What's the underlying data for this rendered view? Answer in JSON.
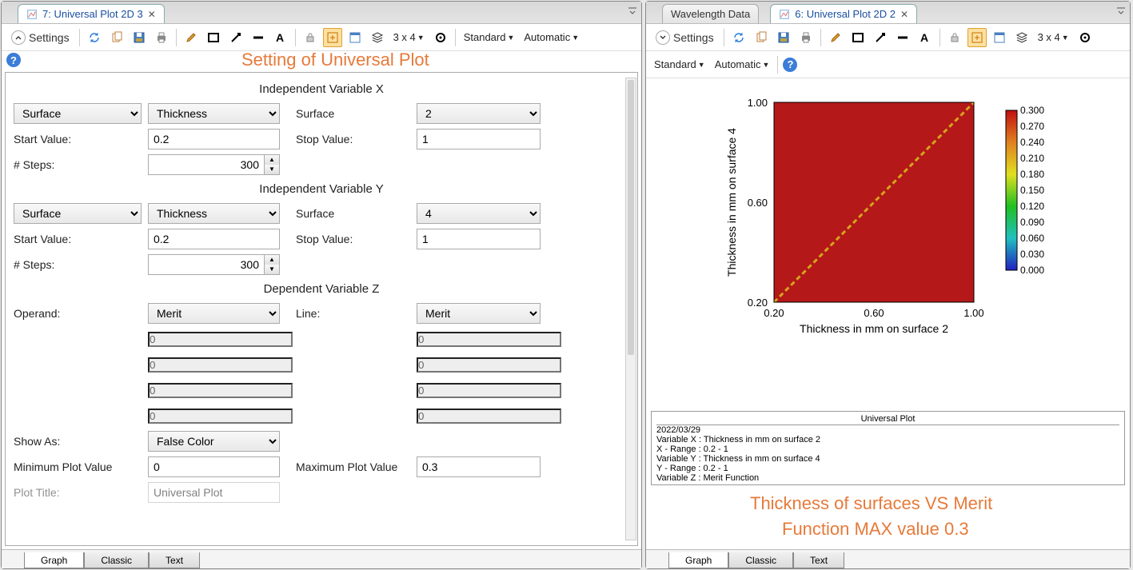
{
  "left": {
    "tab_title": "7: Universal Plot 2D 3",
    "settings_label": "Settings",
    "grid_label": "3 x 4",
    "standard": "Standard",
    "automatic": "Automatic",
    "annotation": "Setting of Universal Plot",
    "sections": {
      "x_title": "Independent Variable X",
      "y_title": "Independent Variable Y",
      "z_title": "Dependent Variable Z"
    },
    "x": {
      "category": "Surface",
      "property": "Thickness",
      "surface_label": "Surface",
      "surface_value": "2",
      "start_label": "Start Value:",
      "start_value": "0.2",
      "stop_label": "Stop Value:",
      "stop_value": "1",
      "steps_label": "# Steps:",
      "steps_value": "300"
    },
    "y": {
      "category": "Surface",
      "property": "Thickness",
      "surface_label": "Surface",
      "surface_value": "4",
      "start_label": "Start Value:",
      "start_value": "0.2",
      "stop_label": "Stop Value:",
      "stop_value": "1",
      "steps_label": "# Steps:",
      "steps_value": "300"
    },
    "z": {
      "operand_label": "Operand:",
      "operand_value": "Merit",
      "line_label": "Line:",
      "line_value": "Merit",
      "p1": "0",
      "p2": "0",
      "p3": "0",
      "p4": "0",
      "q1": "0",
      "q2": "0",
      "q3": "0",
      "q4": "0",
      "showas_label": "Show As:",
      "showas_value": "False Color",
      "min_label": "Minimum Plot Value",
      "min_value": "0",
      "max_label": "Maximum Plot Value",
      "max_value": "0.3",
      "plot_title_label": "Plot Title:",
      "plot_title_value": "Universal Plot"
    },
    "bottom_tabs": [
      "Graph",
      "Classic",
      "Text"
    ]
  },
  "right": {
    "tab_inactive": "Wavelength Data",
    "tab_active": "6: Universal Plot 2D 2",
    "settings_label": "Settings",
    "grid_label": "3 x 4",
    "standard": "Standard",
    "automatic": "Automatic",
    "plot": {
      "xlabel": "Thickness in mm on surface 2",
      "ylabel": "Thickness in mm on surface 4",
      "xticks": [
        "0.20",
        "0.60",
        "1.00"
      ],
      "yticks": [
        "0.20",
        "0.60",
        "1.00"
      ],
      "colorbar": [
        "0.300",
        "0.270",
        "0.240",
        "0.210",
        "0.180",
        "0.150",
        "0.120",
        "0.090",
        "0.060",
        "0.030",
        "0.000"
      ]
    },
    "info_title": "Universal Plot",
    "info_lines": [
      "2022/03/29",
      "Variable X : Thickness in mm on surface 2",
      "X - Range   : 0.2 - 1",
      "Variable Y : Thickness in mm on surface 4",
      "Y - Range   : 0.2 - 1",
      "Variable Z : Merit Function"
    ],
    "annotation1": "Thickness of surfaces VS Merit",
    "annotation2": "Function MAX value 0.3",
    "bottom_tabs": [
      "Graph",
      "Classic",
      "Text"
    ]
  },
  "chart_data": {
    "type": "heatmap",
    "title": "Universal Plot",
    "xlabel": "Thickness in mm on surface 2",
    "ylabel": "Thickness in mm on surface 4",
    "zlabel": "Merit Function",
    "xlim": [
      0.2,
      1.0
    ],
    "ylim": [
      0.2,
      1.0
    ],
    "zlim": [
      0.0,
      0.3
    ],
    "xticks": [
      0.2,
      0.6,
      1.0
    ],
    "yticks": [
      0.2,
      0.6,
      1.0
    ],
    "colorbar_ticks": [
      0.0,
      0.03,
      0.06,
      0.09,
      0.12,
      0.15,
      0.18,
      0.21,
      0.24,
      0.27,
      0.3
    ],
    "note": "Field is uniformly high (~0.3) except a narrow low-value diagonal ridge near x≈y from (0.2,0.2) toward (1.0,1.0)"
  }
}
